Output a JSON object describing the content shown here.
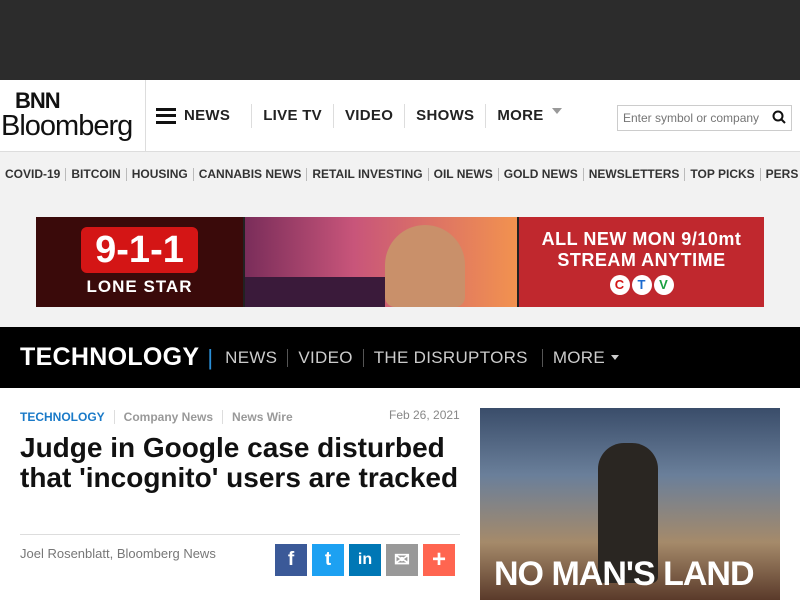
{
  "logo": {
    "line1": "BNN",
    "line2": "Bloomberg"
  },
  "nav": {
    "menu_label": "NEWS",
    "items": [
      "LIVE TV",
      "VIDEO",
      "SHOWS"
    ],
    "more_label": "MORE"
  },
  "search": {
    "placeholder": "Enter symbol or company"
  },
  "subnav": [
    "COVID-19",
    "BITCOIN",
    "HOUSING",
    "CANNABIS NEWS",
    "RETAIL INVESTING",
    "OIL NEWS",
    "GOLD NEWS",
    "NEWSLETTERS",
    "TOP PICKS",
    "PERS"
  ],
  "ad": {
    "show_number": "9-1-1",
    "show_name": "LONE STAR",
    "line1": "ALL NEW MON 9/10mt",
    "line2": "STREAM ANYTIME",
    "network": [
      "C",
      "T",
      "V"
    ]
  },
  "section": {
    "title": "TECHNOLOGY",
    "links": [
      "NEWS",
      "VIDEO",
      "THE DISRUPTORS"
    ],
    "more_label": "MORE"
  },
  "article": {
    "crumbs": [
      "TECHNOLOGY",
      "Company News",
      "News Wire"
    ],
    "date": "Feb 26, 2021",
    "headline": "Judge in Google case disturbed that 'incognito' users are tracked",
    "byline": "Joel Rosenblatt, Bloomberg News"
  },
  "share": {
    "facebook": "f",
    "twitter": "t",
    "linkedin": "in",
    "email": "✉",
    "more": "+"
  },
  "promo": {
    "title": "NO MAN'S LAND"
  },
  "colors": {
    "accent": "#1a7ac8",
    "section_bg": "#000000",
    "ad_red": "#c0282e"
  }
}
